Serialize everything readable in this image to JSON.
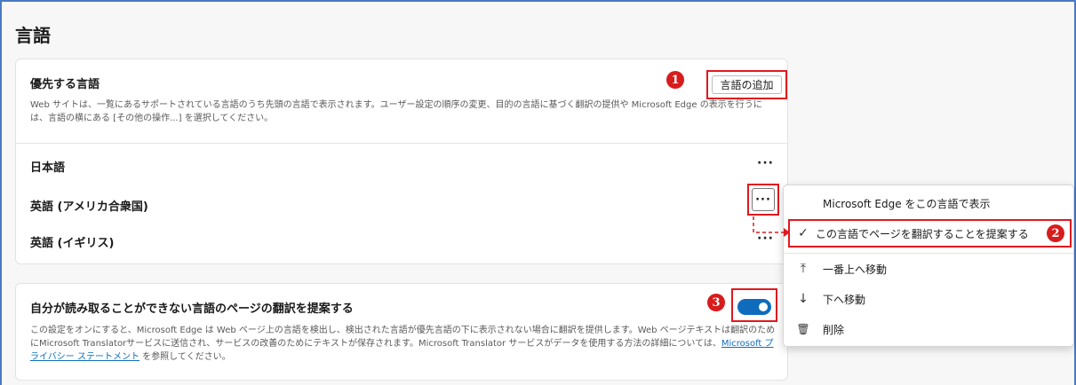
{
  "page": {
    "title": "言語"
  },
  "preferred": {
    "title": "優先する言語",
    "add_button": "言語の追加",
    "description": "Web サイトは、一覧にあるサポートされている言語のうち先頭の言語で表示されます。ユーザー設定の順序の変更、目的の言語に基づく翻訳の提供や Microsoft Edge の表示を行うには、言語の横にある [その他の操作...] を選択してください。",
    "languages": [
      {
        "label": "日本語",
        "more": "···"
      },
      {
        "label": "英語 (アメリカ合衆国)",
        "more": "···"
      },
      {
        "label": "英語 (イギリス)",
        "more": "···"
      }
    ]
  },
  "translate": {
    "title": "自分が読み取ることができない言語のページの翻訳を提案する",
    "toggle_on": true,
    "description_before": "この設定をオンにすると、Microsoft Edge は Web ページ上の言語を検出し、検出された言語が優先言語の下に表示されない場合に翻訳を提供します。Web ページテキストは翻訳のためにMicrosoft Translatorサービスに送信され、サービスの改善のためにテキストが保存されます。Microsoft Translator サービスがデータを使用する方法の詳細については、",
    "link": "Microsoft プライバシー ステートメント",
    "description_after": " を参照してください。"
  },
  "menu": {
    "items": [
      {
        "icon": "",
        "label": "Microsoft Edge をこの言語で表示"
      },
      {
        "icon": "✓",
        "label": "この言語でページを翻訳することを提案する"
      },
      {
        "icon": "⤒",
        "label": "一番上へ移動"
      },
      {
        "icon": "↓",
        "label": "下へ移動"
      },
      {
        "icon": "🗑",
        "label": "削除"
      }
    ]
  },
  "annotations": {
    "badge1": "1",
    "badge2": "2",
    "badge3": "3"
  },
  "colors": {
    "accent": "#0f6cbd",
    "annotation_red": "#e0191f"
  }
}
